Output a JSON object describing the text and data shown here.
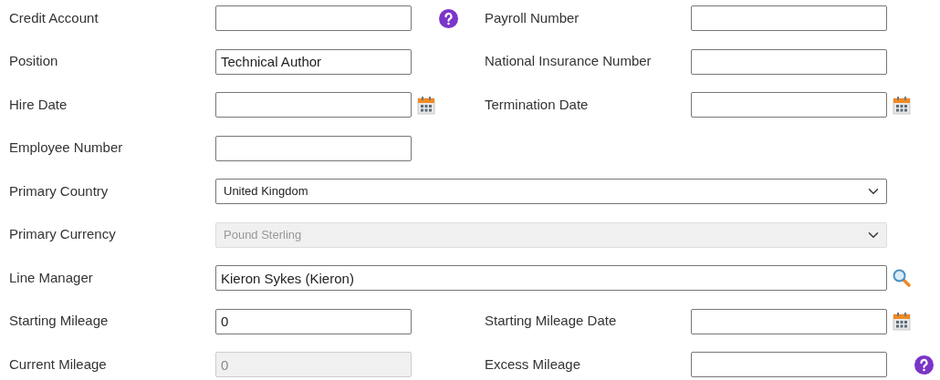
{
  "rows": [
    {
      "fields": [
        {
          "label": "Credit Account",
          "kind": "text",
          "help": true
        },
        {
          "label": "Payroll Number",
          "kind": "text"
        }
      ]
    },
    {
      "fields": [
        {
          "label": "Position",
          "kind": "text",
          "value": "Technical Author"
        },
        {
          "label": "National Insurance Number",
          "kind": "text"
        }
      ]
    },
    {
      "fields": [
        {
          "label": "Hire Date",
          "kind": "date"
        },
        {
          "label": "Termination Date",
          "kind": "date"
        }
      ]
    },
    {
      "fields": [
        {
          "label": "Employee Number",
          "kind": "text"
        }
      ]
    },
    {
      "fields": [
        {
          "label": "Primary Country",
          "kind": "select",
          "value": "United Kingdom",
          "wide": true
        }
      ]
    },
    {
      "fields": [
        {
          "label": "Primary Currency",
          "kind": "select",
          "value": "Pound Sterling",
          "disabled": true,
          "wide": true
        }
      ]
    },
    {
      "fields": [
        {
          "label": "Line Manager",
          "kind": "lookup",
          "value": "Kieron Sykes (Kieron)",
          "wide": true
        }
      ]
    },
    {
      "fields": [
        {
          "label": "Starting Mileage",
          "kind": "text",
          "value": "0"
        },
        {
          "label": "Starting Mileage Date",
          "kind": "date"
        }
      ]
    },
    {
      "fields": [
        {
          "label": "Current Mileage",
          "kind": "text",
          "value": "0",
          "disabled": true
        },
        {
          "label": "Excess Mileage",
          "kind": "text",
          "help": true
        }
      ]
    }
  ]
}
